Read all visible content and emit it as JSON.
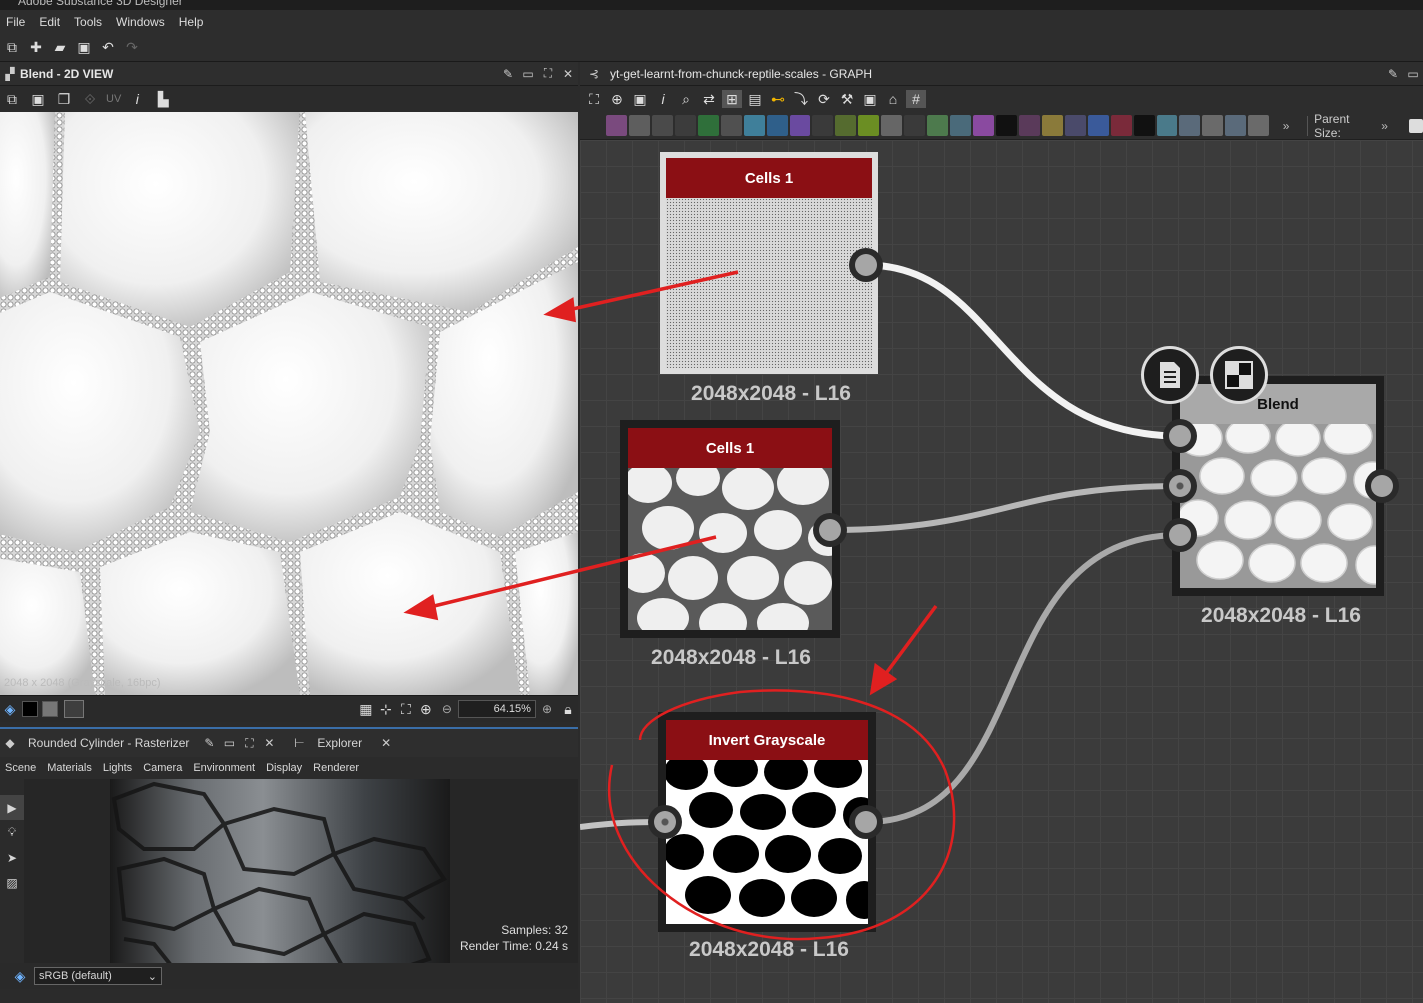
{
  "app": {
    "title": "Adobe Substance 3D Designer"
  },
  "menu": [
    "File",
    "Edit",
    "Tools",
    "Windows",
    "Help"
  ],
  "view2d": {
    "title": "Blend - 2D VIEW",
    "uv_label": "UV",
    "overlay_info": "2048 x 2048 (Grayscale, 16bpc)",
    "zoom": "64.15%"
  },
  "view3d": {
    "title": "Rounded Cylinder - Rasterizer",
    "explorer_tab": "Explorer",
    "tabs": [
      "Scene",
      "Materials",
      "Lights",
      "Camera",
      "Environment",
      "Display",
      "Renderer"
    ],
    "samples": "Samples: 32",
    "render_time": "Render Time: 0.24 s",
    "color_space": "sRGB (default)"
  },
  "graph": {
    "title": "yt-get-learnt-from-chunck-reptile-scales - GRAPH",
    "parent_size_label": "Parent Size:",
    "nodes": [
      {
        "title": "Cells 1",
        "subtitle": "2048x2048 - L16"
      },
      {
        "title": "Cells 1",
        "subtitle": "2048x2048 - L16"
      },
      {
        "title": "Invert Grayscale",
        "subtitle": "2048x2048 - L16"
      },
      {
        "title": "Blend",
        "subtitle": "2048x2048 - L16"
      }
    ]
  },
  "colors": {
    "node_title": "#8b0f14",
    "annotation": "#e02020",
    "accent_tab": "#3a6ea8"
  },
  "icons": [
    "new-graph-icon",
    "import-icon",
    "open-icon",
    "save-all-icon",
    "undo-icon",
    "redo-icon",
    "pin-icon",
    "maximize-icon",
    "close-icon",
    "info-icon",
    "histogram-icon",
    "camera-icon",
    "light-icon",
    "select-icon",
    "environment-icon",
    "comment-icon",
    "checker-icon"
  ]
}
